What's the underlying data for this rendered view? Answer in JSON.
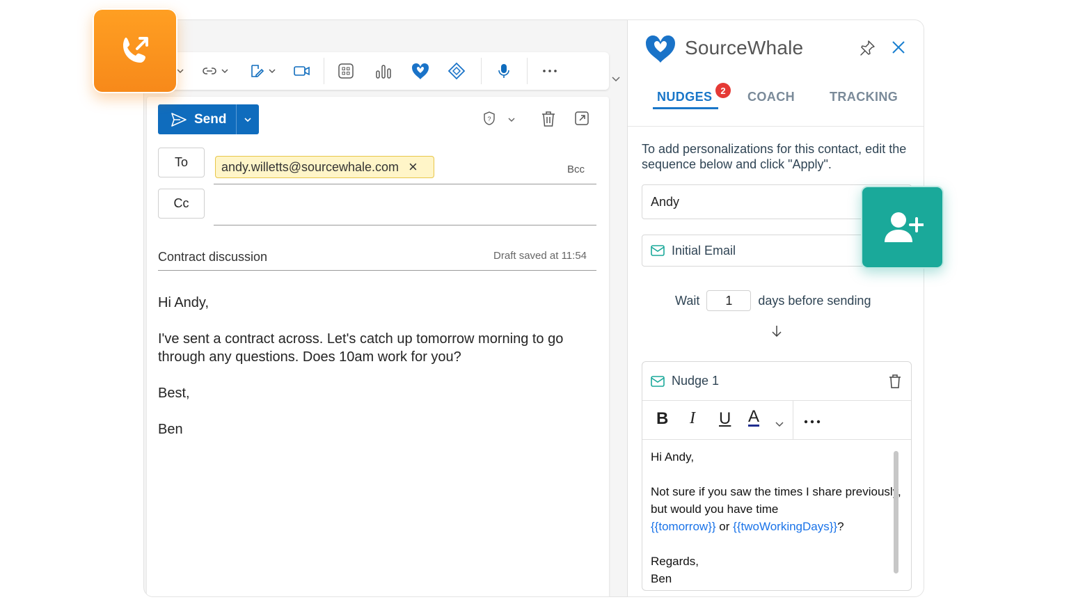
{
  "compose": {
    "send_label": "Send",
    "to_label": "To",
    "cc_label": "Cc",
    "bcc_label": "Bcc",
    "to_recipient": "andy.willetts@sourcewhale.com",
    "subject": "Contract discussion",
    "draft_status": "Draft saved at 11:54",
    "body": {
      "greeting": "Hi Andy,",
      "paragraph": "I've sent a contract across. Let's catch up tomorrow morning to go through any questions. Does 10am work for you?",
      "signoff": "Best,",
      "name": "Ben"
    }
  },
  "side_panel": {
    "brand": "SourceWhale",
    "tabs": [
      {
        "label": "NUDGES",
        "badge": "2",
        "active": true
      },
      {
        "label": "COACH"
      },
      {
        "label": "TRACKING"
      }
    ],
    "instructions": "To add personalizations for this contact, edit the sequence below and click \"Apply\".",
    "name_field_value": "Andy",
    "initial_email_label": "Initial Email",
    "wait": {
      "prefix": "Wait",
      "value": "1",
      "suffix": "days before sending"
    },
    "nudge": {
      "title": "Nudge 1",
      "body_greeting": "Hi Andy,",
      "body_line1": "Not sure if you saw the times I share previously, but would you have time",
      "var_tomorrow": "{{tomorrow}}",
      "or_word": "or",
      "var_two_days": "{{twoWorkingDays}}",
      "qmark": "?",
      "regards": "Regards,",
      "sign_name": "Ben"
    }
  },
  "colors": {
    "primary_blue": "#0f6cbd",
    "tab_active": "#1976c8",
    "badge_red": "#e53935",
    "call_tile_orange": "#f7891a",
    "contact_tile_teal": "#1aa99a",
    "chip_yellow": "#fff5c8"
  },
  "icons": {
    "call_tile": "phone-outgoing-icon",
    "contact_tile": "add-user-icon"
  }
}
